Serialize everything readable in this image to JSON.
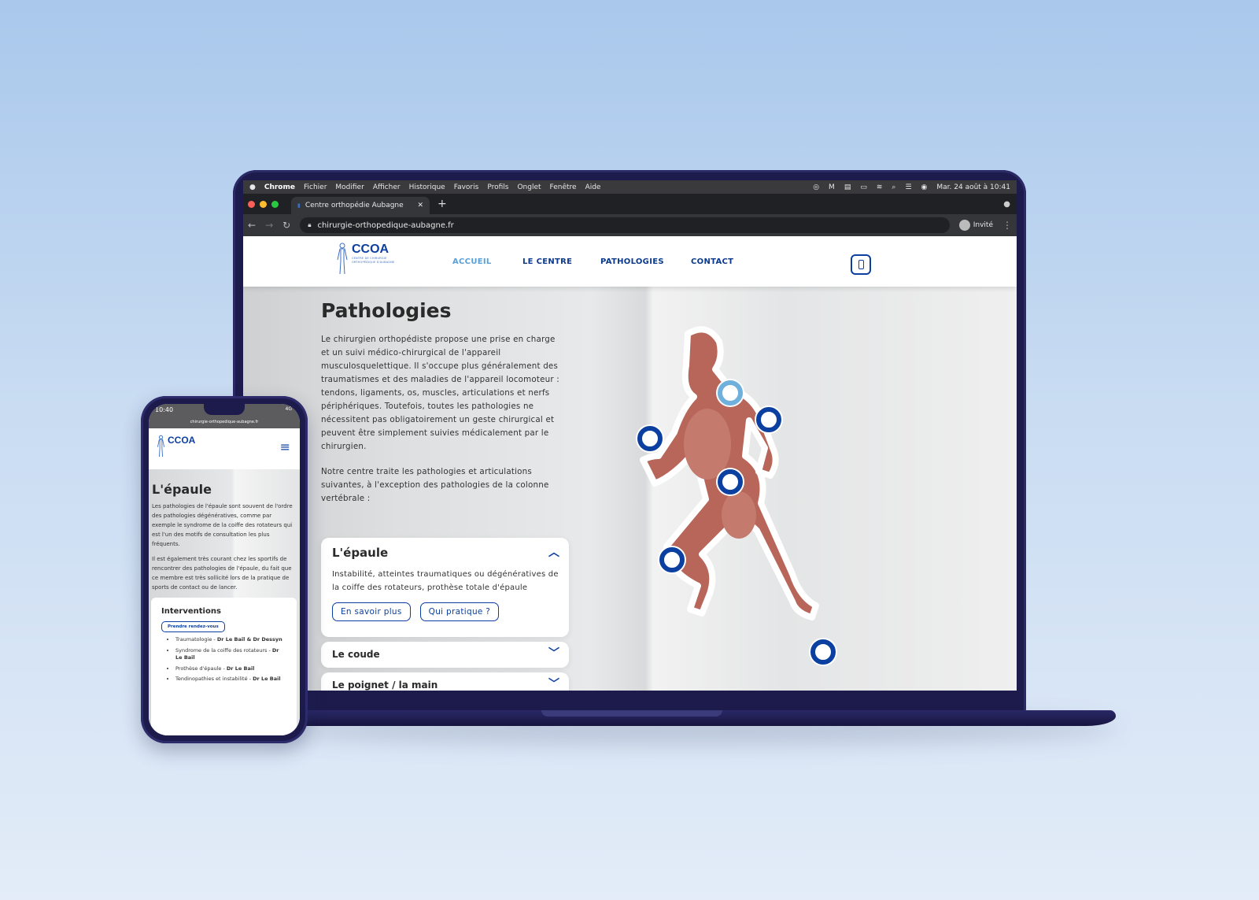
{
  "macos_menubar": {
    "app": "Chrome",
    "items": [
      "Fichier",
      "Modifier",
      "Afficher",
      "Historique",
      "Favoris",
      "Profils",
      "Onglet",
      "Fenêtre",
      "Aide"
    ],
    "clock": "Mar. 24 août à 10:41"
  },
  "browser": {
    "tab_title": "Centre orthopédie Aubagne",
    "url": "chirurgie-orthopedique-aubagne.fr",
    "profile": "Invité"
  },
  "site": {
    "logo": {
      "name": "CCOA",
      "subtitle_line1": "CENTRE DE CHIRURGIE",
      "subtitle_line2": "ORTHOPÉDIQUE D'AUBAGNE"
    },
    "nav": [
      {
        "label": "ACCUEIL",
        "active": true
      },
      {
        "label": "LE CENTRE"
      },
      {
        "label": "PATHOLOGIES"
      },
      {
        "label": "CONTACT"
      }
    ],
    "accent": "#0b3fa0",
    "active_nav_color": "#5aa0d8"
  },
  "page": {
    "title": "Pathologies",
    "intro": "Le chirurgien orthopédiste propose une prise en charge et un suivi médico-chirurgical de l'appareil musculosquelettique. Il s'occupe plus généralement des traumatismes et des maladies de l'appareil locomoteur : tendons, ligaments, os, muscles, articulations et nerfs périphériques. Toutefois, toutes les pathologies ne nécessitent pas obligatoirement un geste chirurgical et peuvent être simplement suivies médicalement par le chirurgien.",
    "intro2": "Notre centre traite les pathologies et articulations suivantes, à l'exception des pathologies de la colonne vertébrale :",
    "accordion": [
      {
        "title": "L'épaule",
        "expanded": true,
        "text": "Instabilité, atteintes traumatiques ou dégénératives de la coiffe des rotateurs, prothèse totale d'épaule",
        "buttons": [
          "En savoir plus",
          "Qui pratique ?"
        ]
      },
      {
        "title": "Le coude",
        "expanded": false
      },
      {
        "title": "Le poignet / la main",
        "expanded": false
      }
    ],
    "hotspots": [
      {
        "joint": "shoulder",
        "selected": true
      },
      {
        "joint": "elbow"
      },
      {
        "joint": "wrist"
      },
      {
        "joint": "hip"
      },
      {
        "joint": "knee"
      },
      {
        "joint": "ankle"
      }
    ]
  },
  "phone": {
    "time": "10:40",
    "network": "4G",
    "url": "chirurgie-orthopedique-aubagne.fr",
    "title": "L'épaule",
    "p1": "Les pathologies de l'épaule sont souvent de l'ordre des pathologies dégénératives, comme par exemple le syndrome de la coiffe des rotateurs qui est l'un des motifs de consultation les plus fréquents.",
    "p2": "Il est également très courant chez les sportifs de rencontrer des pathologies de l'épaule, du fait que ce membre est très sollicité lors de la pratique de sports de contact ou de lancer.",
    "interventions_title": "Interventions",
    "cta": "Prendre rendez-vous",
    "interventions": [
      {
        "name": "Traumatologie - ",
        "doctor": "Dr Le Bail & Dr Dessyn"
      },
      {
        "name": "Syndrome de la coiffe des rotateurs - ",
        "doctor": "Dr Le Bail"
      },
      {
        "name": "Prothèse d'épaule - ",
        "doctor": "Dr Le Bail"
      },
      {
        "name": "Tendinopathies et instabilité - ",
        "doctor": "Dr Le Bail"
      }
    ]
  }
}
